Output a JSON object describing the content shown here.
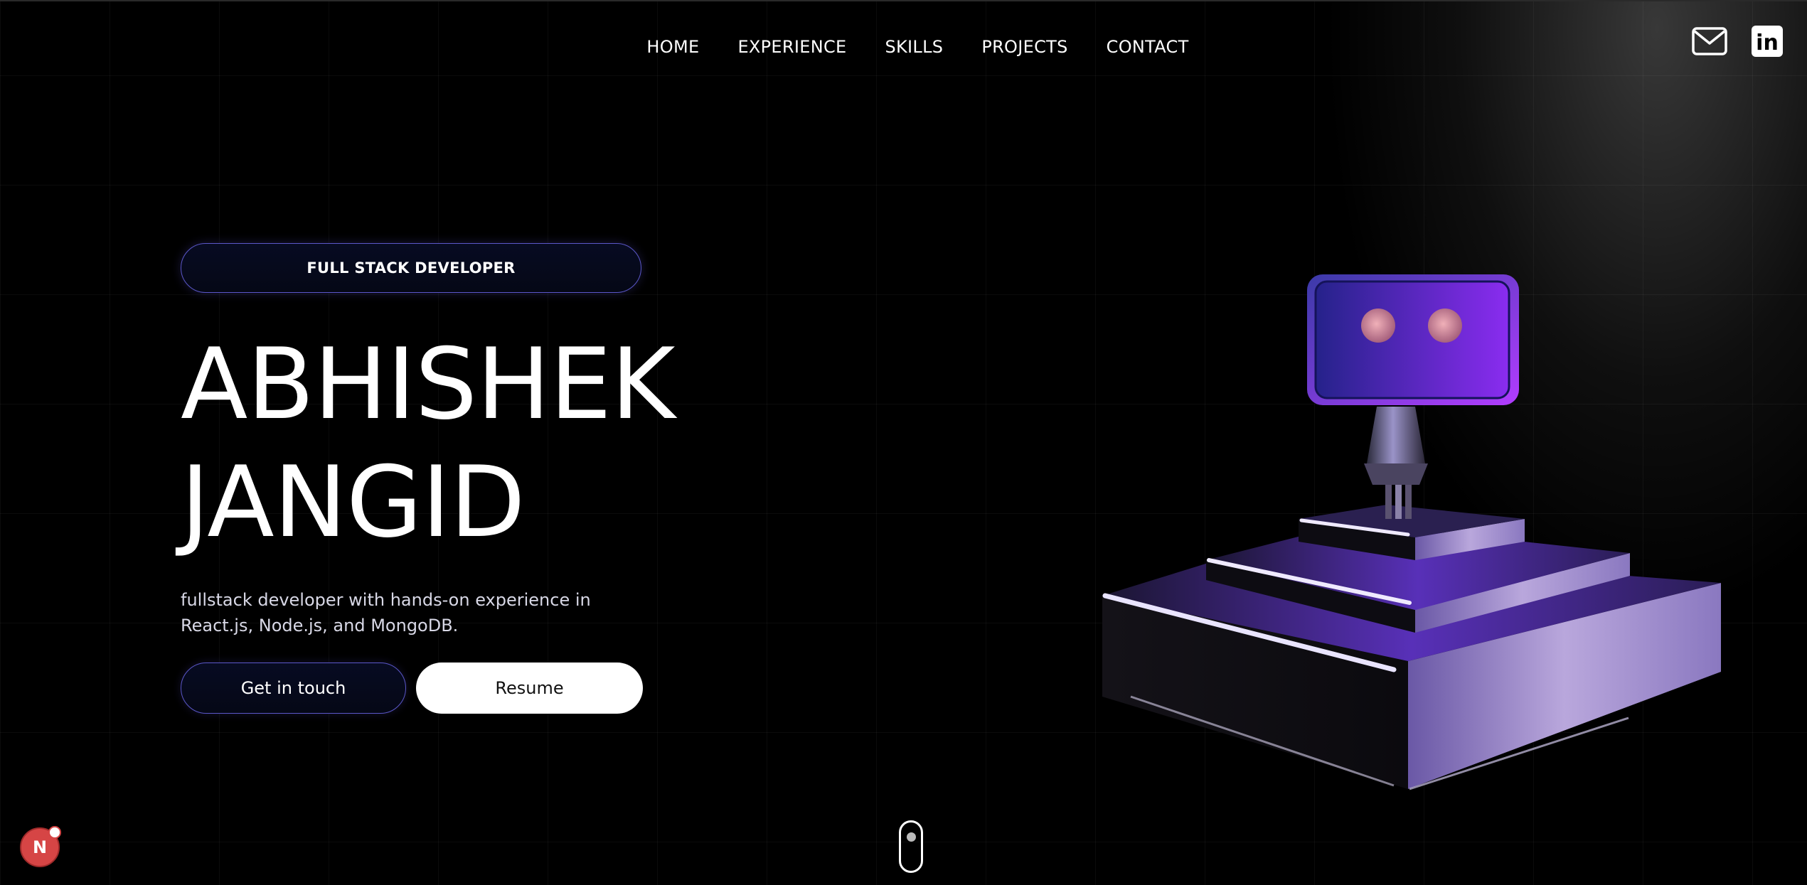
{
  "nav": {
    "items": [
      {
        "label": "HOME"
      },
      {
        "label": "EXPERIENCE"
      },
      {
        "label": "SKILLS"
      },
      {
        "label": "PROJECTS"
      },
      {
        "label": "CONTACT"
      }
    ]
  },
  "social": {
    "mail_icon": "mail-icon",
    "linkedin_icon": "linkedin-icon",
    "linkedin_text": "in"
  },
  "hero": {
    "role": "FULL STACK DEVELOPER",
    "first_name": "ABHISHEK",
    "last_name": "JANGID",
    "description": "fullstack developer with hands-on experience in React.js, Node.js, and MongoDB.",
    "cta_primary": "Get in touch",
    "cta_secondary": "Resume"
  },
  "badge": {
    "letter": "N"
  },
  "colors": {
    "background": "#000000",
    "accent": "#5b57c9",
    "robot_purple": "#7b2ff0",
    "badge_red": "#d64545"
  }
}
